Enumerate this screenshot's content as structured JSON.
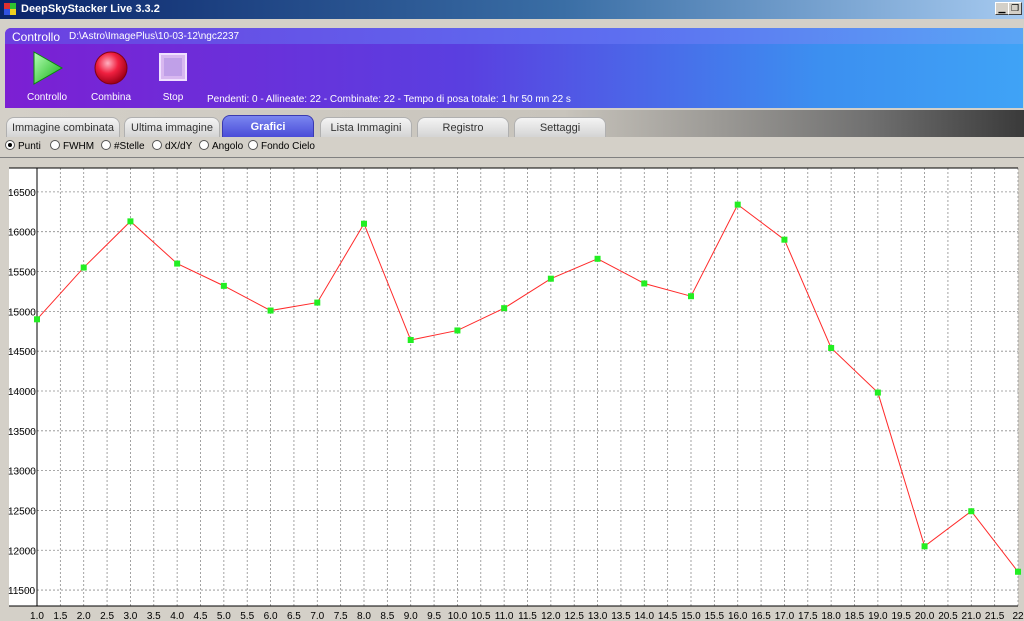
{
  "window": {
    "title": "DeepSkyStacker Live 3.3.2"
  },
  "control_panel": {
    "title": "Controllo",
    "path": "D:\\Astro\\ImagePlus\\10-03-12\\ngc2237",
    "tools": [
      {
        "label": "Controllo",
        "icon": "play-icon"
      },
      {
        "label": "Combina",
        "icon": "record-icon"
      },
      {
        "label": "Stop",
        "icon": "stop-icon"
      }
    ],
    "status": "Pendenti: 0 - Allineate: 22 - Combinate: 22 - Tempo di posa totale: 1 hr 50 mn 22 s"
  },
  "tabs": [
    {
      "label": "Immagine combinata"
    },
    {
      "label": "Ultima immagine"
    },
    {
      "label": "Grafici",
      "active": true
    },
    {
      "label": "Lista Immagini"
    },
    {
      "label": "Registro"
    },
    {
      "label": "Settaggi"
    }
  ],
  "graph_options": [
    {
      "label": "Punti",
      "selected": true
    },
    {
      "label": "FWHM"
    },
    {
      "label": "#Stelle"
    },
    {
      "label": "dX/dY"
    },
    {
      "label": "Angolo"
    },
    {
      "label": "Fondo Cielo"
    }
  ],
  "colors": {
    "line": "#ff2a2a",
    "point": "#22ee22",
    "grid": "#8c8c8c"
  },
  "chart_data": {
    "type": "line",
    "x": [
      1,
      2,
      3,
      4,
      5,
      6,
      7,
      8,
      9,
      10,
      11,
      12,
      13,
      14,
      15,
      16,
      17,
      18,
      19,
      20,
      21,
      22
    ],
    "values": [
      14900,
      15550,
      16130,
      15600,
      15320,
      15010,
      15110,
      16100,
      14640,
      14760,
      15040,
      15410,
      15660,
      15350,
      15190,
      16340,
      15900,
      14540,
      13980,
      12050,
      12490,
      11730
    ],
    "x_ticks": [
      "1.0",
      "1.5",
      "2.0",
      "2.5",
      "3.0",
      "3.5",
      "4.0",
      "4.5",
      "5.0",
      "5.5",
      "6.0",
      "6.5",
      "7.0",
      "7.5",
      "8.0",
      "8.5",
      "9.0",
      "9.5",
      "10.0",
      "10.5",
      "11.0",
      "11.5",
      "12.0",
      "12.5",
      "13.0",
      "13.5",
      "14.0",
      "14.5",
      "15.0",
      "15.5",
      "16.0",
      "16.5",
      "17.0",
      "17.5",
      "18.0",
      "18.5",
      "19.0",
      "19.5",
      "20.0",
      "20.5",
      "21.0",
      "21.5",
      "22"
    ],
    "y_ticks": [
      "16500",
      "16000",
      "15500",
      "15000",
      "14500",
      "14000",
      "13500",
      "13000",
      "12500",
      "12000",
      "11500"
    ],
    "y_tick_values": [
      16500,
      16000,
      15500,
      15000,
      14500,
      14000,
      13500,
      13000,
      12500,
      12000,
      11500
    ],
    "xlim": [
      1,
      22
    ],
    "ylim": [
      11300,
      16800
    ],
    "grid": true
  }
}
